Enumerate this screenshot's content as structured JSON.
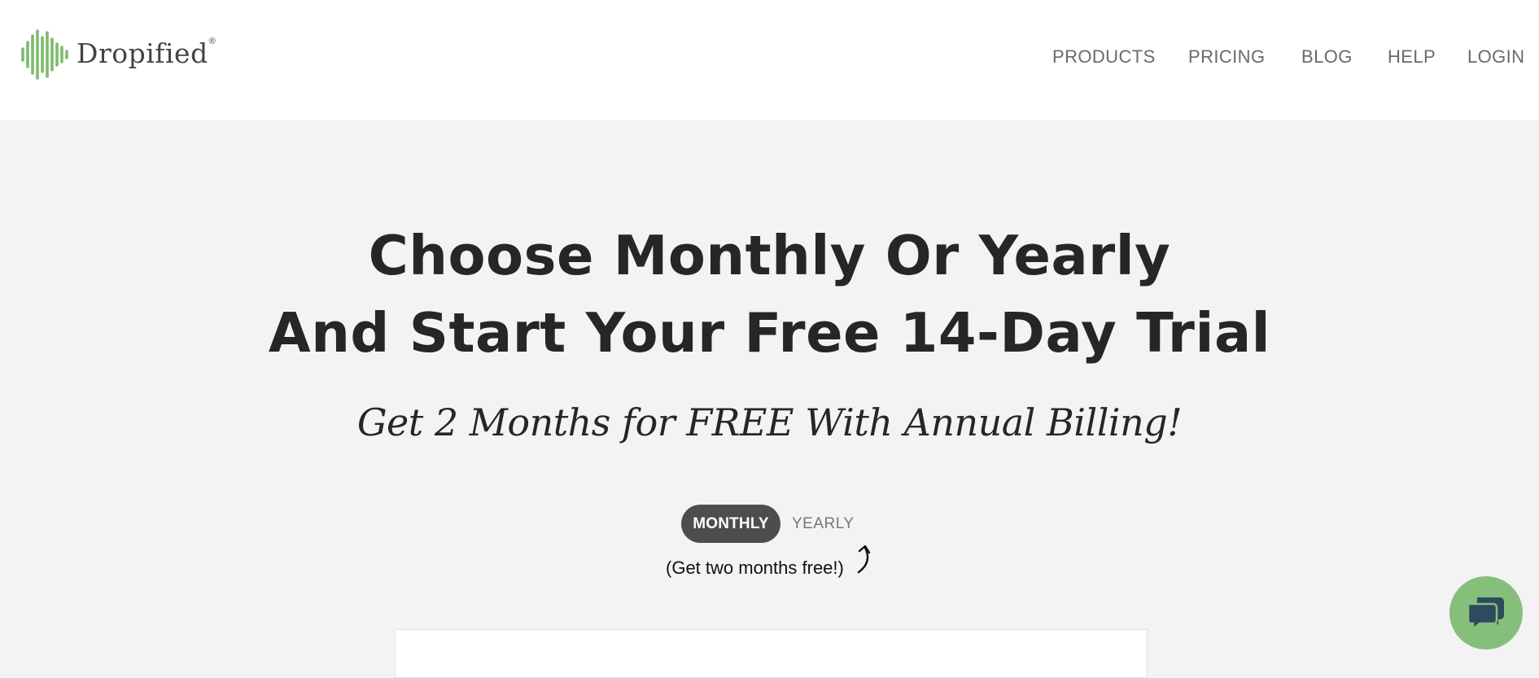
{
  "header": {
    "logo": {
      "name": "Dropified",
      "registered": "®",
      "icon": "soundwave-logo-icon",
      "color": "#7dbb6c"
    },
    "nav": [
      {
        "label": "PRODUCTS"
      },
      {
        "label": "PRICING"
      },
      {
        "label": "BLOG"
      },
      {
        "label": "HELP"
      },
      {
        "label": "LOGIN"
      }
    ]
  },
  "hero": {
    "title_line1": "Choose Monthly Or Yearly",
    "title_line2": "And Start Your Free 14-Day Trial",
    "subtitle": "Get 2 Months for FREE With Annual Billing!"
  },
  "billing_toggle": {
    "options": [
      {
        "label": "MONTHLY",
        "selected": true
      },
      {
        "label": "YEARLY",
        "selected": false
      }
    ],
    "note": "(Get two months free!)",
    "note_icon": "curved-arrow-up-icon"
  },
  "chat": {
    "icon": "chat-bubbles-icon",
    "color": "#86be7b"
  },
  "colors": {
    "background": "#f3f3f3",
    "header": "#ffffff",
    "title": "#262626",
    "toggle_active": "#4d4d4d",
    "nav_text": "#6a6a6a"
  }
}
